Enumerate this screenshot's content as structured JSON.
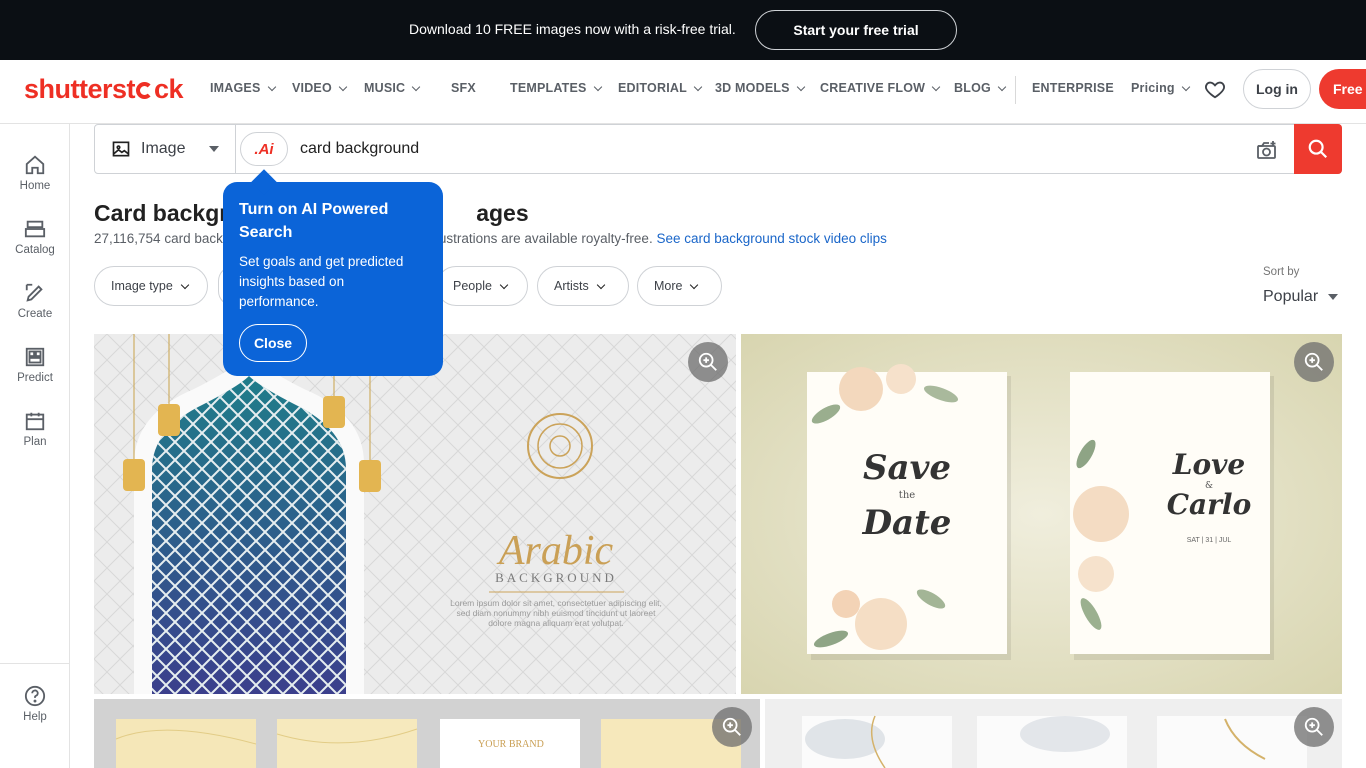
{
  "promo": {
    "text": "Download 10 FREE images now with a risk-free trial.",
    "button": "Start your free trial"
  },
  "logo": "shutterstock",
  "nav": {
    "items": [
      "IMAGES",
      "VIDEO",
      "MUSIC",
      "SFX",
      "TEMPLATES",
      "EDITORIAL",
      "3D MODELS",
      "CREATIVE FLOW",
      "BLOG",
      "ENTERPRISE",
      "Pricing"
    ],
    "login": "Log in",
    "free": "Free t"
  },
  "sidebar": {
    "items": [
      "Home",
      "Catalog",
      "Create",
      "Predict",
      "Plan"
    ],
    "help": "Help"
  },
  "search": {
    "type": "Image",
    "ai_badge": ".Ai",
    "query": "card background"
  },
  "results": {
    "title_start": "Card backgr",
    "title_end": "ages",
    "count_text": "27,116,754 card back",
    "count_rest": "llustrations are available royalty-free.",
    "video_link": "See card background stock video clips"
  },
  "filters": [
    "Image type",
    "People",
    "Artists",
    "More"
  ],
  "sort": {
    "label": "Sort by",
    "value": "Popular"
  },
  "tooltip": {
    "title": "Turn on AI Powered Search",
    "body": "Set goals and get predicted insights based on performance.",
    "close": "Close"
  },
  "images": {
    "arabic": {
      "title": "Arabic",
      "subtitle": "BACKGROUND",
      "lorem": "Lorem ipsum dolor sit amet, consectetuer adipiscing elit, sed diam nonummy nibh euismod tincidunt ut laoreet dolore magna aliquam erat volutpat."
    },
    "wedding": {
      "save1": "Save",
      "save2": "the",
      "save3": "Date",
      "love1": "Love",
      "love2": "&",
      "love3": "Carlo",
      "date": "SAT | 31 | JUL"
    },
    "brand": "YOUR BRAND"
  },
  "colors": {
    "accent": "#ee3a2f",
    "link": "#1a66c9",
    "tooltip": "#0b64d8",
    "promo_bg": "#0b0f14"
  }
}
